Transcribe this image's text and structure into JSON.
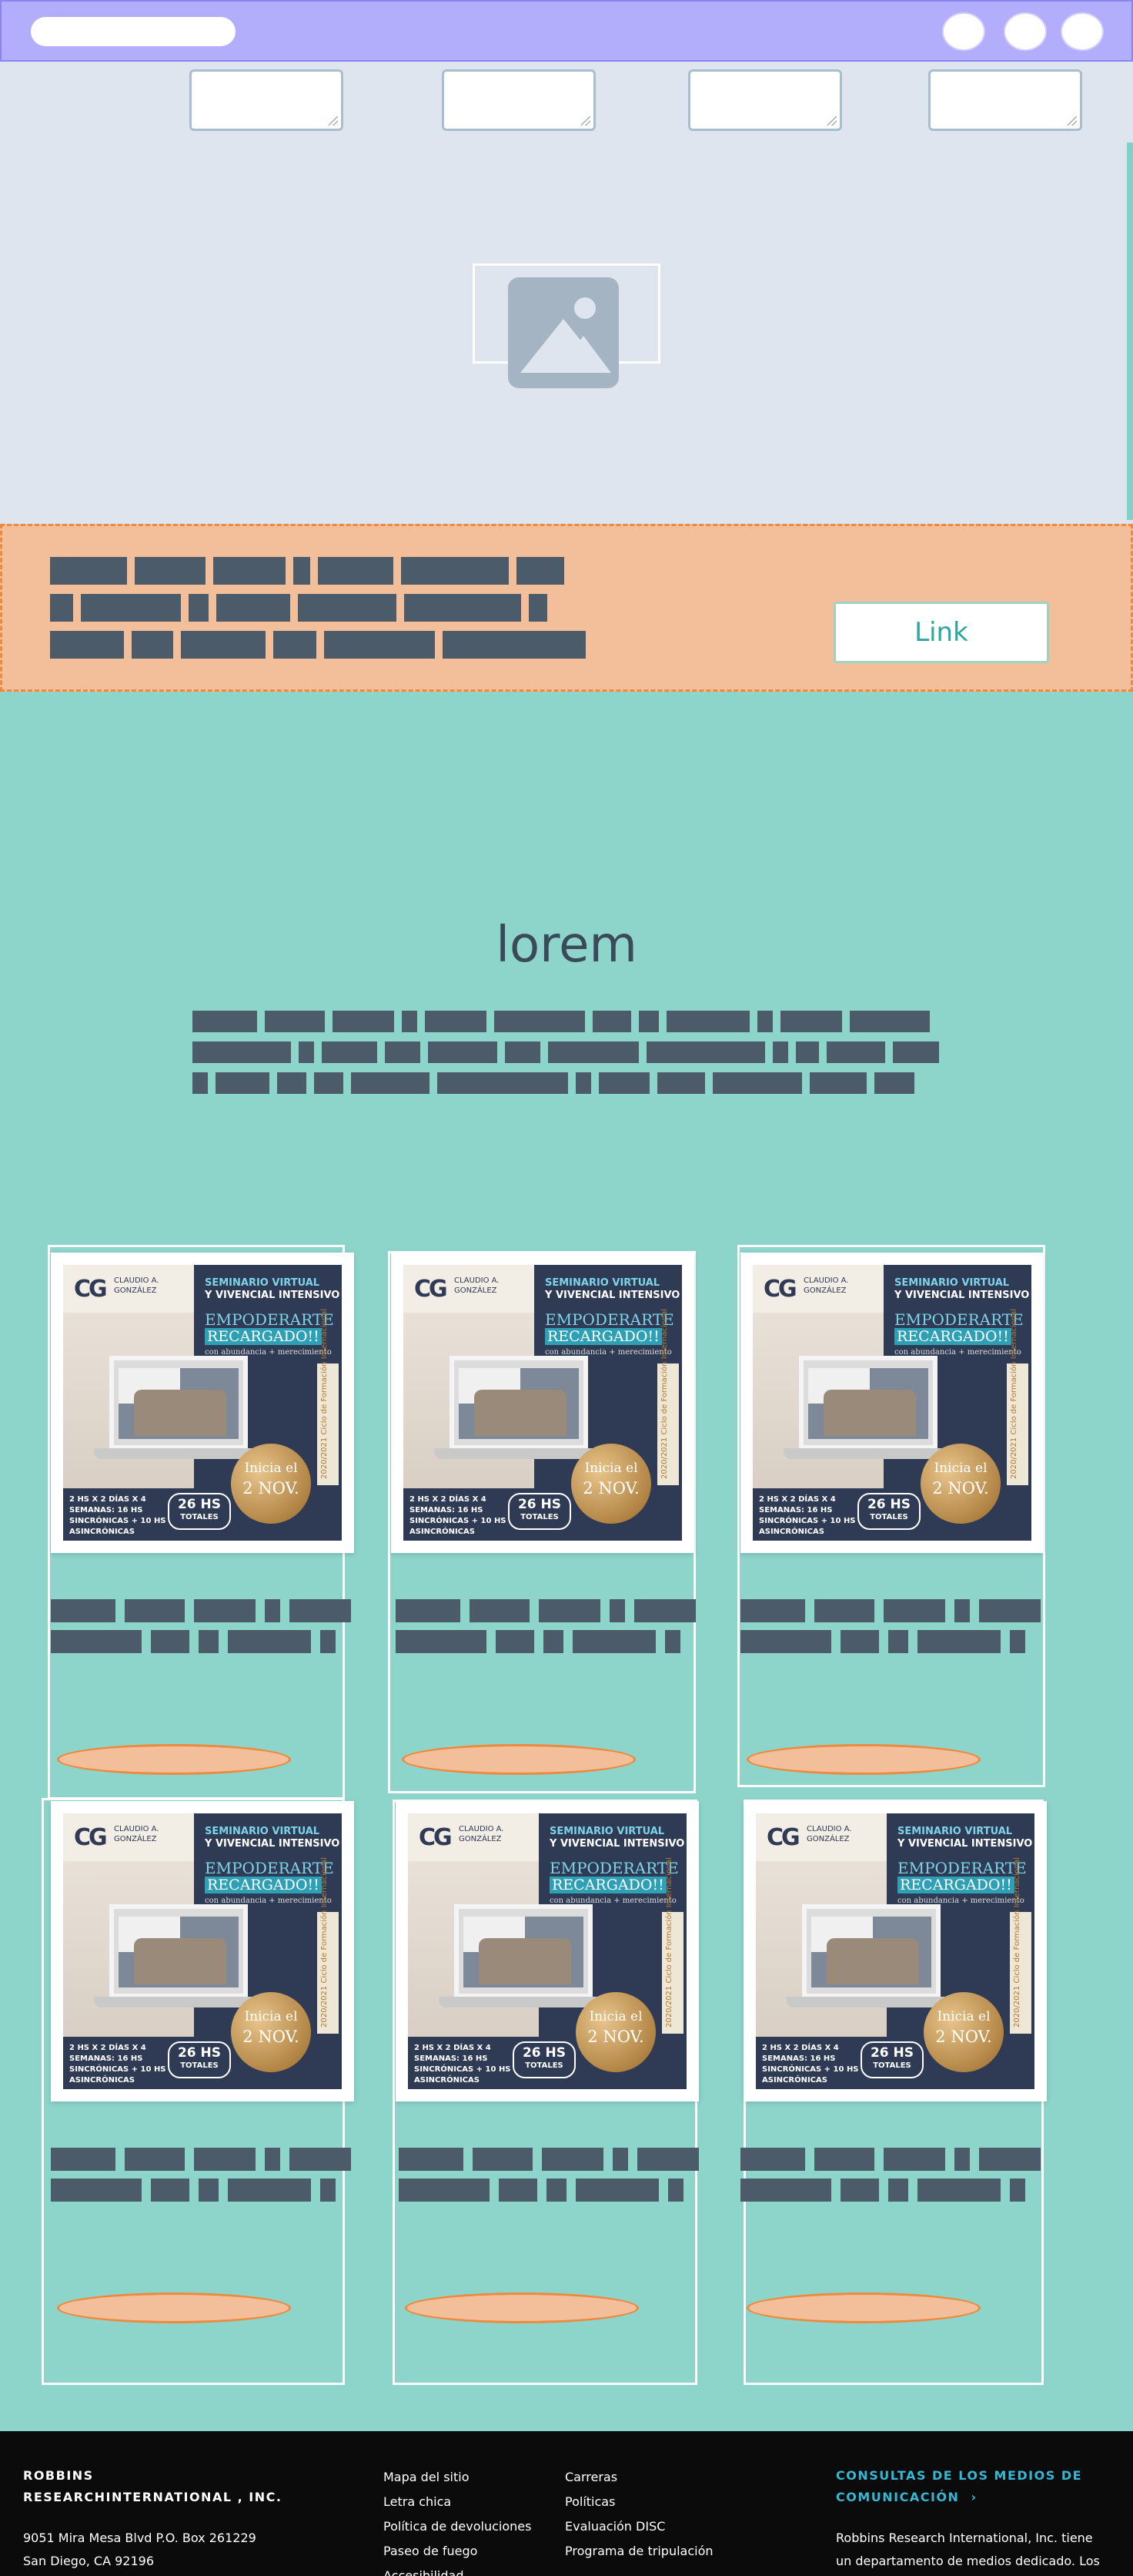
{
  "banner": {
    "link_label": "Link"
  },
  "section": {
    "title": "lorem"
  },
  "posters": {
    "brand_initials": "CG",
    "brand_name_line1": "CLAUDIO A.",
    "brand_name_line2": "GONZÁLEZ",
    "headline_line1": "SEMINARIO VIRTUAL",
    "headline_line2": "Y VIVENCIAL INTENSIVO",
    "title_line1": "EMPODERARTE",
    "title_line2": "RECARGADO!!",
    "subtitle": "con abundancia + merecimiento",
    "schedule_text": "2 HS X 2 DÍAS X 4 SEMANAS: 16 HS SINCRÓNICAS + 10 HS ASINCRÓNICAS",
    "hours_value": "26 HS",
    "hours_label": "TOTALES",
    "start_line1": "Inicia el",
    "start_line2": "2 NOV.",
    "side_text": "2020/2021 Ciclo de Formación Internacional"
  },
  "footer": {
    "company_name": "ROBBINS RESEARCHINTERNATIONAL , INC.",
    "address_line1": "9051 Mira Mesa Blvd P.O. Box 261229",
    "address_line2": "San Diego, CA 92196",
    "links_col1": [
      "Mapa del sitio",
      "Letra chica",
      "Política de devoluciones",
      "Paseo de fuego",
      "Accesibilidad"
    ],
    "links_col2": [
      "Carreras",
      "Políticas",
      "Evaluación DISC",
      "Programa de tripulación"
    ],
    "media_heading": "CONSULTAS DE LOS MEDIOS DE COMUNICACIÓN",
    "media_chevron": "›",
    "media_text": "Robbins Research International, Inc. tiene un departamento de medios dedicado. Los"
  }
}
